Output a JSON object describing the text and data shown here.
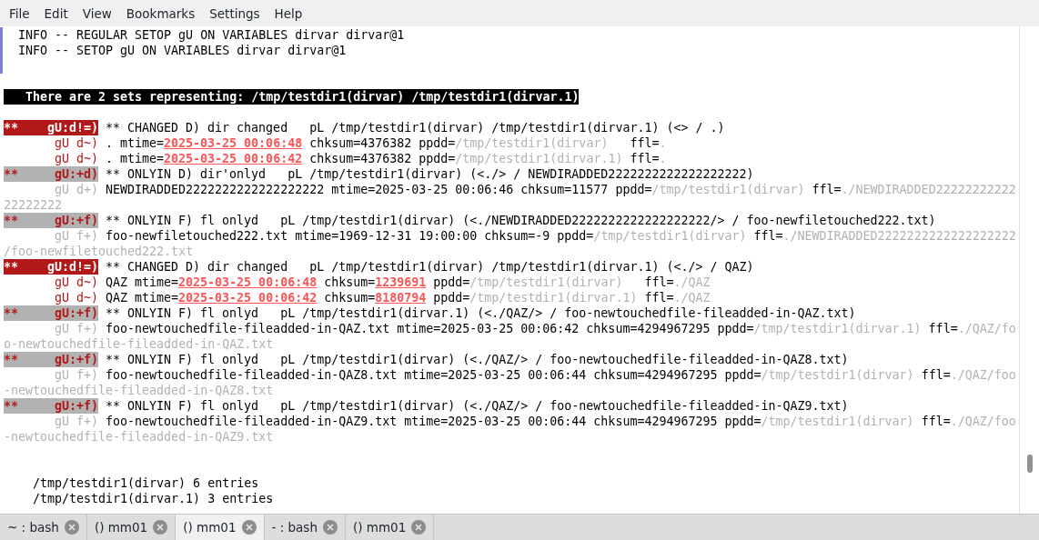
{
  "menu": [
    "File",
    "Edit",
    "View",
    "Bookmarks",
    "Settings",
    "Help"
  ],
  "lines": [
    {
      "kind": "info",
      "text": "INFO -- REGULAR SETOP gU ON VARIABLES dirvar dirvar@1"
    },
    {
      "kind": "info",
      "text": "INFO -- SETOP gU ON VARIABLES dirvar dirvar@1"
    },
    {
      "kind": "blank"
    },
    {
      "kind": "blank"
    },
    {
      "kind": "banner",
      "text": "There are 2 sets representing: /tmp/testdir1(dirvar) /tmp/testdir1(dirvar.1)"
    },
    {
      "kind": "blank"
    },
    {
      "kind": "entry",
      "tag": {
        "kind": "changed",
        "marker": "**",
        "code": "gU:d!=)"
      },
      "segments": [
        {
          "kind": "plain",
          "text": "** CHANGED D) dir changed   pL /tmp/testdir1(dirvar) /tmp/testdir1(dirvar.1) (<> / .)"
        }
      ]
    },
    {
      "kind": "entry",
      "tag": {
        "kind": "detail",
        "code": "gU d~)"
      },
      "segments": [
        {
          "kind": "plain",
          "text": ". mtime="
        },
        {
          "kind": "alert",
          "text": "2025-03-25 00:06:48"
        },
        {
          "kind": "plain",
          "text": " chksum=4376382 ppdd="
        },
        {
          "kind": "dim",
          "text": "/tmp/testdir1(dirvar)"
        },
        {
          "kind": "plain",
          "text": "   ffl="
        },
        {
          "kind": "dim",
          "text": "."
        }
      ]
    },
    {
      "kind": "entry",
      "tag": {
        "kind": "detail",
        "code": "gU d~)"
      },
      "segments": [
        {
          "kind": "plain",
          "text": ". mtime="
        },
        {
          "kind": "alert",
          "text": "2025-03-25 00:06:42"
        },
        {
          "kind": "plain",
          "text": " chksum=4376382 ppdd="
        },
        {
          "kind": "dim",
          "text": "/tmp/testdir1(dirvar.1)"
        },
        {
          "kind": "plain",
          "text": " ffl="
        },
        {
          "kind": "dim",
          "text": "."
        }
      ]
    },
    {
      "kind": "entry",
      "tag": {
        "kind": "onlyin",
        "marker": "**",
        "code": "gU:+d)"
      },
      "segments": [
        {
          "kind": "plain",
          "text": "** ONLYIN D) dir'onlyd   pL /tmp/testdir1(dirvar) (<./> / NEWDIRADDED2222222222222222222)"
        }
      ]
    },
    {
      "kind": "entry",
      "tag": {
        "kind": "added",
        "code": "gU d+)"
      },
      "segments": [
        {
          "kind": "plain",
          "text": "NEWDIRADDED2222222222222222222 mtime=2025-03-25 00:06:46 chksum=11577 ppdd="
        },
        {
          "kind": "dim",
          "text": "/tmp/testdir1(dirvar)"
        },
        {
          "kind": "plain",
          "text": " ffl="
        },
        {
          "kind": "dim",
          "text": "./NEWDIRADDED22222222222"
        }
      ]
    },
    {
      "kind": "wrap",
      "text": "22222222"
    },
    {
      "kind": "entry",
      "tag": {
        "kind": "onlyin",
        "marker": "**",
        "code": "gU:+f)"
      },
      "segments": [
        {
          "kind": "plain",
          "text": "** ONLYIN F) fl onlyd   pL /tmp/testdir1(dirvar) (<./NEWDIRADDED2222222222222222222/> / foo-newfiletouched222.txt)"
        }
      ]
    },
    {
      "kind": "entry",
      "tag": {
        "kind": "added",
        "code": "gU f+)"
      },
      "segments": [
        {
          "kind": "plain",
          "text": "foo-newfiletouched222.txt mtime=1969-12-31 19:00:00 chksum=-9 ppdd="
        },
        {
          "kind": "dim",
          "text": "/tmp/testdir1(dirvar)"
        },
        {
          "kind": "plain",
          "text": " ffl="
        },
        {
          "kind": "dim",
          "text": "./NEWDIRADDED2222222222222222222"
        }
      ]
    },
    {
      "kind": "wrap",
      "text": "/foo-newfiletouched222.txt"
    },
    {
      "kind": "entry",
      "tag": {
        "kind": "changed",
        "marker": "**",
        "code": "gU:d!=)"
      },
      "segments": [
        {
          "kind": "plain",
          "text": "** CHANGED D) dir changed   pL /tmp/testdir1(dirvar) /tmp/testdir1(dirvar.1) (<./> / QAZ)"
        }
      ]
    },
    {
      "kind": "entry",
      "tag": {
        "kind": "detail",
        "code": "gU d~)"
      },
      "segments": [
        {
          "kind": "plain",
          "text": "QAZ mtime="
        },
        {
          "kind": "alert",
          "text": "2025-03-25 00:06:48"
        },
        {
          "kind": "plain",
          "text": " chksum="
        },
        {
          "kind": "alert",
          "text": "1239691"
        },
        {
          "kind": "plain",
          "text": " ppdd="
        },
        {
          "kind": "dim",
          "text": "/tmp/testdir1(dirvar)"
        },
        {
          "kind": "plain",
          "text": "   ffl="
        },
        {
          "kind": "dim",
          "text": "./QAZ"
        }
      ]
    },
    {
      "kind": "entry",
      "tag": {
        "kind": "detail",
        "code": "gU d~)"
      },
      "segments": [
        {
          "kind": "plain",
          "text": "QAZ mtime="
        },
        {
          "kind": "alert",
          "text": "2025-03-25 00:06:42"
        },
        {
          "kind": "plain",
          "text": " chksum="
        },
        {
          "kind": "alert",
          "text": "8180794"
        },
        {
          "kind": "plain",
          "text": " ppdd="
        },
        {
          "kind": "dim",
          "text": "/tmp/testdir1(dirvar.1)"
        },
        {
          "kind": "plain",
          "text": " ffl="
        },
        {
          "kind": "dim",
          "text": "./QAZ"
        }
      ]
    },
    {
      "kind": "entry",
      "tag": {
        "kind": "onlyin",
        "marker": "**",
        "code": "gU:+f)"
      },
      "segments": [
        {
          "kind": "plain",
          "text": "** ONLYIN F) fl onlyd   pL /tmp/testdir1(dirvar.1) (<./QAZ/> / foo-newtouchedfile-fileadded-in-QAZ.txt)"
        }
      ]
    },
    {
      "kind": "entry",
      "tag": {
        "kind": "added",
        "code": "gU f+)"
      },
      "segments": [
        {
          "kind": "plain",
          "text": "foo-newtouchedfile-fileadded-in-QAZ.txt mtime=2025-03-25 00:06:42 chksum=4294967295 ppdd="
        },
        {
          "kind": "dim",
          "text": "/tmp/testdir1(dirvar.1)"
        },
        {
          "kind": "plain",
          "text": " ffl="
        },
        {
          "kind": "dim",
          "text": "./QAZ/fo"
        }
      ]
    },
    {
      "kind": "wrap",
      "text": "o-newtouchedfile-fileadded-in-QAZ.txt"
    },
    {
      "kind": "entry",
      "tag": {
        "kind": "onlyin",
        "marker": "**",
        "code": "gU:+f)"
      },
      "segments": [
        {
          "kind": "plain",
          "text": "** ONLYIN F) fl onlyd   pL /tmp/testdir1(dirvar) (<./QAZ/> / foo-newtouchedfile-fileadded-in-QAZ8.txt)"
        }
      ]
    },
    {
      "kind": "entry",
      "tag": {
        "kind": "added",
        "code": "gU f+)"
      },
      "segments": [
        {
          "kind": "plain",
          "text": "foo-newtouchedfile-fileadded-in-QAZ8.txt mtime=2025-03-25 00:06:44 chksum=4294967295 ppdd="
        },
        {
          "kind": "dim",
          "text": "/tmp/testdir1(dirvar)"
        },
        {
          "kind": "plain",
          "text": " ffl="
        },
        {
          "kind": "dim",
          "text": "./QAZ/foo"
        }
      ]
    },
    {
      "kind": "wrap",
      "text": "-newtouchedfile-fileadded-in-QAZ8.txt"
    },
    {
      "kind": "entry",
      "tag": {
        "kind": "onlyin",
        "marker": "**",
        "code": "gU:+f)"
      },
      "segments": [
        {
          "kind": "plain",
          "text": "** ONLYIN F) fl onlyd   pL /tmp/testdir1(dirvar) (<./QAZ/> / foo-newtouchedfile-fileadded-in-QAZ9.txt)"
        }
      ]
    },
    {
      "kind": "entry",
      "tag": {
        "kind": "added",
        "code": "gU f+)"
      },
      "segments": [
        {
          "kind": "plain",
          "text": "foo-newtouchedfile-fileadded-in-QAZ9.txt mtime=2025-03-25 00:06:44 chksum=4294967295 ppdd="
        },
        {
          "kind": "dim",
          "text": "/tmp/testdir1(dirvar)"
        },
        {
          "kind": "plain",
          "text": " ffl="
        },
        {
          "kind": "dim",
          "text": "./QAZ/foo"
        }
      ]
    },
    {
      "kind": "wrap",
      "text": "-newtouchedfile-fileadded-in-QAZ9.txt"
    },
    {
      "kind": "blank"
    },
    {
      "kind": "blank"
    },
    {
      "kind": "summary",
      "text": "/tmp/testdir1(dirvar) 6 entries"
    },
    {
      "kind": "summary",
      "text": "/tmp/testdir1(dirvar.1) 3 entries"
    }
  ],
  "tabs": [
    {
      "label": "~ : bash",
      "selected": false
    },
    {
      "label": "() mm01",
      "selected": false
    },
    {
      "label": "() mm01",
      "selected": true
    },
    {
      "label": "- : bash",
      "selected": false
    },
    {
      "label": "() mm01",
      "selected": false
    }
  ]
}
